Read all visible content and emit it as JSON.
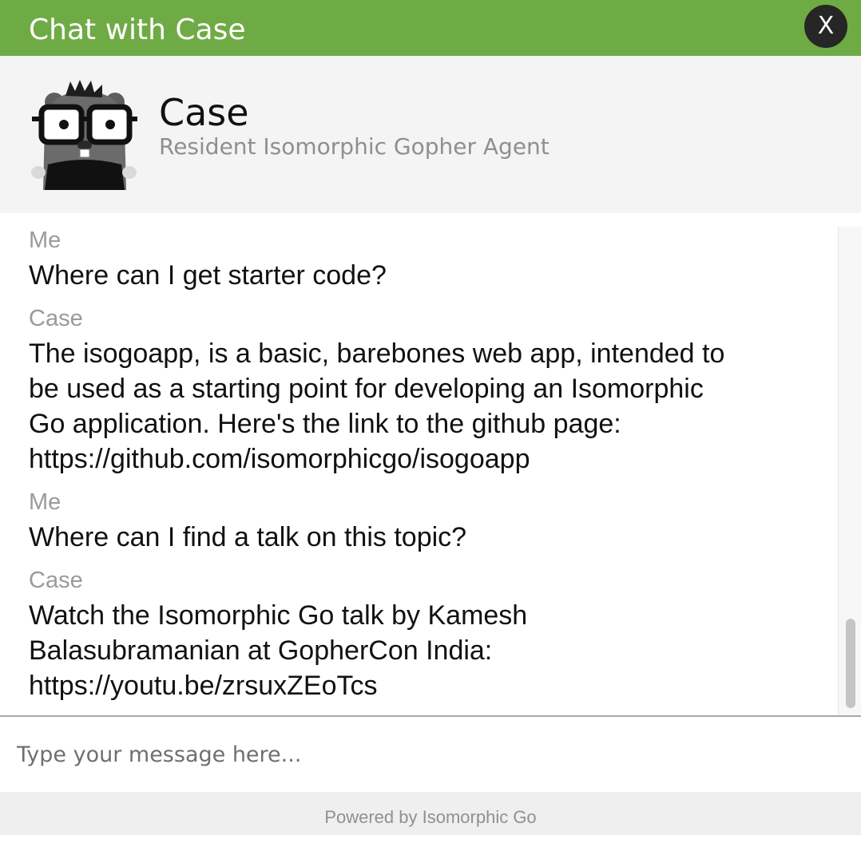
{
  "window": {
    "title": "Chat with Case",
    "close_label": "X"
  },
  "agent": {
    "name": "Case",
    "role": "Resident Isomorphic Gopher Agent",
    "avatar_icon": "gopher-avatar-icon"
  },
  "messages": [
    {
      "sender": "Me",
      "text": "Where can I get starter code?"
    },
    {
      "sender": "Case",
      "lines": [
        "The isogoapp, is a basic, barebones web app, intended to",
        "be used as a starting point for developing an Isomorphic",
        "Go application. Here's the link to the github page:",
        "https://github.com/isomorphicgo/isogoapp"
      ]
    },
    {
      "sender": "Me",
      "text": "Where can I find a talk on this topic?"
    },
    {
      "sender": "Case",
      "lines": [
        "Watch the Isomorphic Go talk by Kamesh",
        "Balasubramanian at GopherCon India:",
        "https://youtu.be/zrsuxZEoTcs"
      ]
    }
  ],
  "input": {
    "placeholder": "Type your message here...",
    "value": ""
  },
  "footer": {
    "text": "Powered by Isomorphic Go"
  },
  "colors": {
    "accent": "#6fab45",
    "close_button": "#262626",
    "header_bg": "#f4f4f4",
    "sender_text": "#9a9a9a"
  }
}
